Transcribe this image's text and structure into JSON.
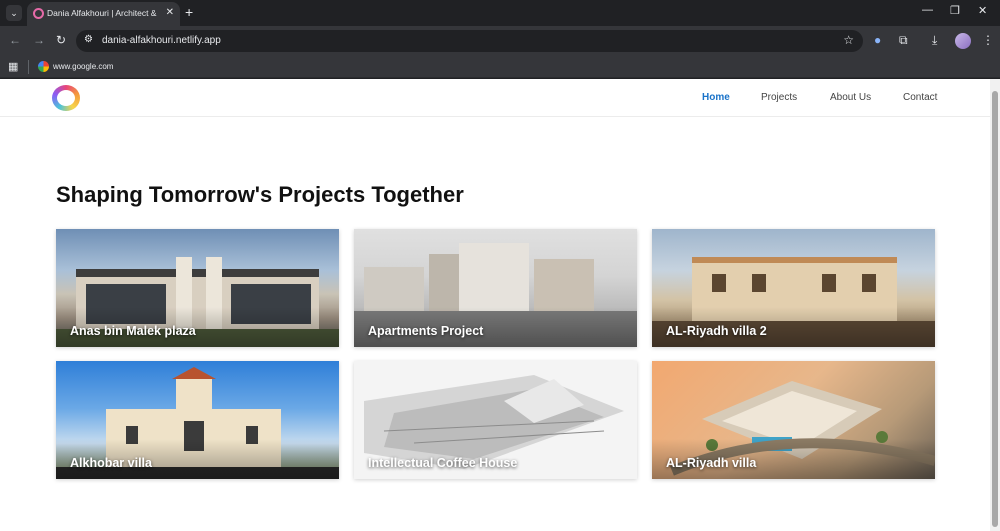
{
  "browser": {
    "tab_title": "Dania Alfakhouri | Architect & I",
    "new_tab_glyph": "+",
    "close_glyph": "✕",
    "url": "dania-alfakhouri.netlify.app",
    "bookmark": "www.google.com",
    "icons": [
      "tab-search-icon",
      "back-icon",
      "forward-icon",
      "reload-icon",
      "site-info-icon",
      "star-icon",
      "extension-icon",
      "puzzle-icon",
      "download-icon",
      "avatar",
      "kebab-menu-icon",
      "minimize-icon",
      "restore-icon",
      "close-window-icon",
      "apps-icon",
      "google-icon"
    ]
  },
  "site": {
    "nav": [
      {
        "label": "Home",
        "active": true
      },
      {
        "label": "Projects",
        "active": false
      },
      {
        "label": "About Us",
        "active": false
      },
      {
        "label": "Contact",
        "active": false
      }
    ],
    "heading": "Shaping Tomorrow's Projects Together",
    "projects": [
      {
        "label": "Anas bin Malek plaza"
      },
      {
        "label": "Apartments Project"
      },
      {
        "label": "AL-Riyadh villa 2"
      },
      {
        "label": "Alkhobar villa"
      },
      {
        "label": "Intellectual Coffee House"
      },
      {
        "label": "AL-Riyadh villa"
      }
    ]
  },
  "colors": {
    "accent": "#1a73c9",
    "chrome_dark": "#202124",
    "chrome_mid": "#35363a"
  }
}
